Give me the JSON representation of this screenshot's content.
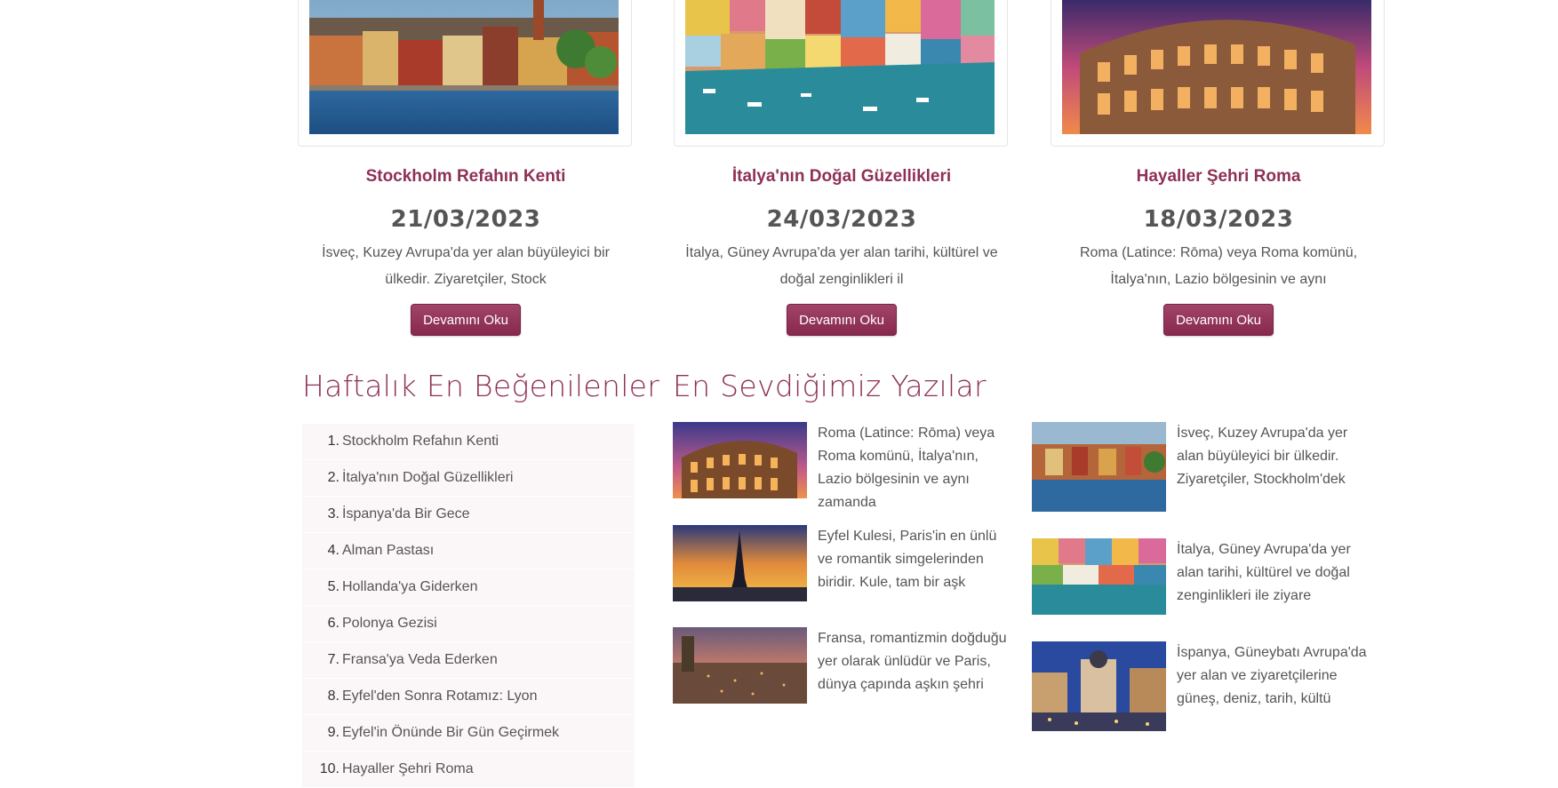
{
  "cards": [
    {
      "title": "Stockholm Refahın Kenti",
      "date": "21/03/2023",
      "excerpt": "İsveç, Kuzey Avrupa'da yer alan büyüleyici bir ülkedir. Ziyaretçiler, Stock",
      "button": "Devamını Oku"
    },
    {
      "title": "İtalya'nın Doğal Güzellikleri",
      "date": "24/03/2023",
      "excerpt": "İtalya, Güney Avrupa'da yer alan tarihi, kültürel ve doğal zenginlikleri il",
      "button": "Devamını Oku"
    },
    {
      "title": "Hayaller Şehri Roma",
      "date": "18/03/2023",
      "excerpt": "Roma (Latince: Rōma) veya Roma komünü, İtalya'nın, Lazio bölgesinin ve aynı",
      "button": "Devamını Oku"
    }
  ],
  "weekly": {
    "heading": "Haftalık En Beğenilenler",
    "items": [
      {
        "num": "1.",
        "label": "Stockholm Refahın Kenti"
      },
      {
        "num": "2.",
        "label": "İtalya'nın Doğal Güzellikleri"
      },
      {
        "num": "3.",
        "label": "İspanya'da Bir Gece"
      },
      {
        "num": "4.",
        "label": "Alman Pastası"
      },
      {
        "num": "5.",
        "label": "Hollanda'ya Giderken"
      },
      {
        "num": "6.",
        "label": "Polonya Gezisi"
      },
      {
        "num": "7.",
        "label": "Fransa'ya Veda Ederken"
      },
      {
        "num": "8.",
        "label": "Eyfel'den Sonra Rotamız: Lyon"
      },
      {
        "num": "9.",
        "label": "Eyfel'in Önünde Bir Gün Geçirmek"
      },
      {
        "num": "10.",
        "label": "Hayaller Şehri Roma"
      }
    ]
  },
  "favorites": {
    "heading": "En Sevdiğimiz Yazılar",
    "items": [
      {
        "text": "Roma (Latince: Rōma) veya Roma komünü, İtalya'nın, Lazio bölgesinin ve aynı zamanda"
      },
      {
        "text": "Eyfel Kulesi, Paris'in en ünlü ve romantik simgelerinden biridir. Kule, tam bir aşk"
      },
      {
        "text": "Fransa, romantizmin doğduğu yer olarak ünlüdür ve Paris, dünya çapında aşkın şehri"
      },
      {
        "text": "İsveç, Kuzey Avrupa'da yer alan büyüleyici bir ülkedir. Ziyaretçiler, Stockholm'dek"
      },
      {
        "text": "İtalya, Güney Avrupa'da yer alan tarihi, kültürel ve doğal zenginlikleri ile ziyare"
      },
      {
        "text": "İspanya, Güneybatı Avrupa'da yer alan ve ziyaretçilerine güneş, deniz, tarih, kültü"
      }
    ]
  }
}
